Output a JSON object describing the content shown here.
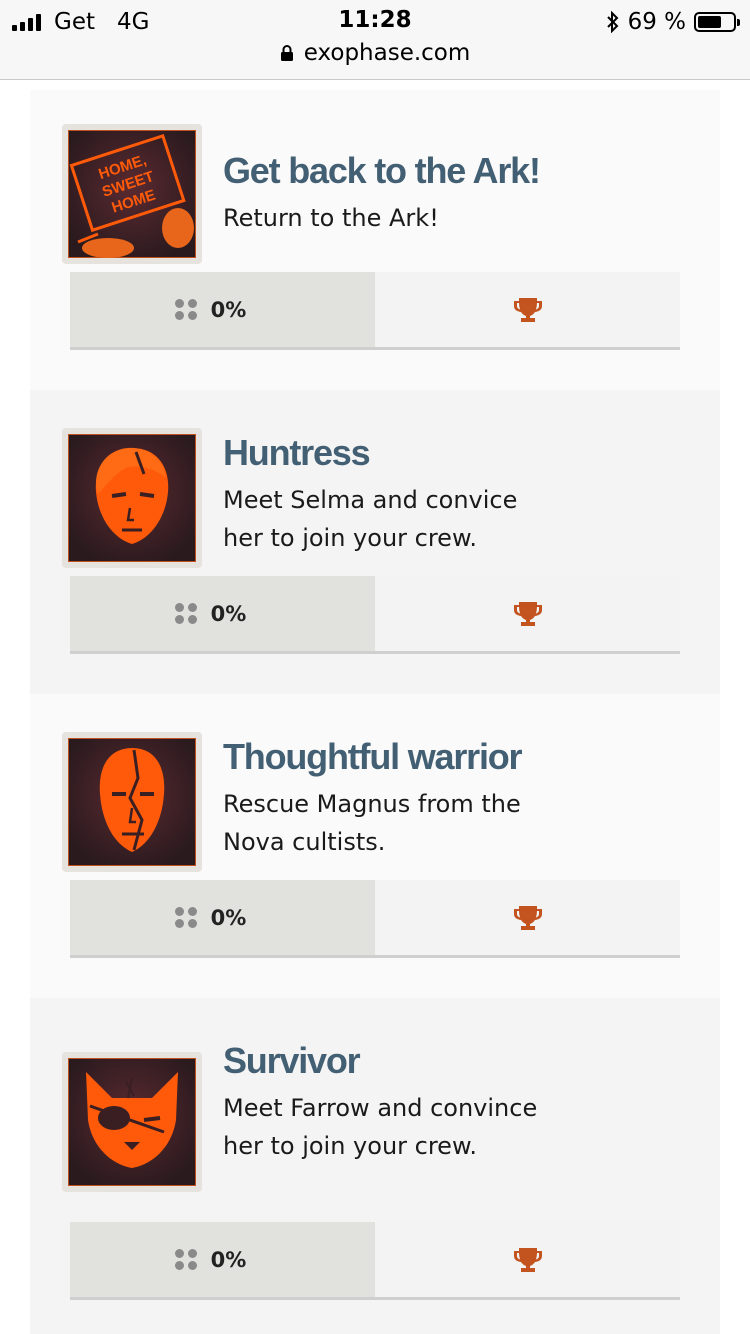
{
  "status_bar": {
    "carrier": "Get",
    "network": "4G",
    "time": "11:28",
    "battery_text": "69 %",
    "battery_level": 0.69
  },
  "browser": {
    "url": "exophase.com"
  },
  "colors": {
    "title": "#435f73",
    "trophy": "#c4541f",
    "icon_orange": "#ff5a0a",
    "icon_bg": "#3a1f22"
  },
  "achievements": [
    {
      "title": "Get back to the Ark!",
      "description": "Return to the Ark!",
      "progress": "0%",
      "icon": "home-sweet-home-icon",
      "icon_text": [
        "HOME,",
        "SWEET",
        "HOME"
      ]
    },
    {
      "title": "Huntress",
      "description": "Meet Selma and convice her to join your crew.",
      "progress": "0%",
      "icon": "huntress-face-icon"
    },
    {
      "title": "Thoughtful warrior",
      "description": "Rescue Magnus from the Nova cultists.",
      "progress": "0%",
      "icon": "warrior-face-icon"
    },
    {
      "title": "Survivor",
      "description": "Meet Farrow and convince her to join your crew.",
      "progress": "0%",
      "icon": "fox-face-icon"
    }
  ]
}
